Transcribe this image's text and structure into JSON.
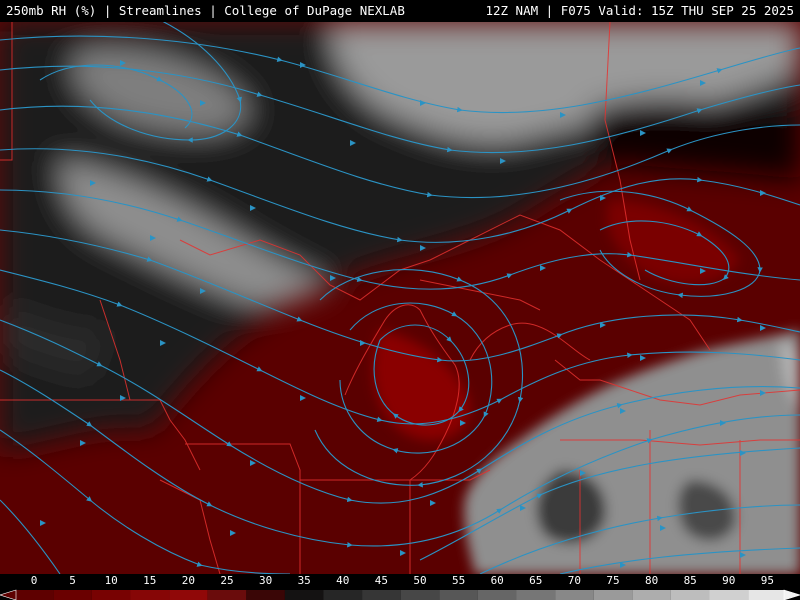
{
  "header": {
    "title": "250mb RH (%) | Streamlines | College of DuPage NEXLAB",
    "run_info": "12Z NAM | F075 Valid: 15Z THU SEP 25 2025"
  },
  "colorbar": {
    "ticks": [
      "0",
      "5",
      "10",
      "15",
      "20",
      "25",
      "30",
      "35",
      "40",
      "45",
      "50",
      "55",
      "60",
      "65",
      "70",
      "75",
      "80",
      "85",
      "90",
      "95"
    ],
    "colors": [
      "#5e0000",
      "#6a0000",
      "#780202",
      "#860606",
      "#900808",
      "#6a0c0c",
      "#3a0606",
      "#141212",
      "#262626",
      "#363636",
      "#474747",
      "#575757",
      "#666666",
      "#767676",
      "#888888",
      "#9a9a9a",
      "#adadad",
      "#bdbdbd",
      "#d0d0d0",
      "#e6e6e6"
    ]
  },
  "colors": {
    "background": "#000000",
    "header_text": "#ffffff",
    "streamline": "#2b93c4",
    "borders": "#e5312f",
    "dry_fill": "#7a0505",
    "moist_fill": "#8c8c8c"
  }
}
